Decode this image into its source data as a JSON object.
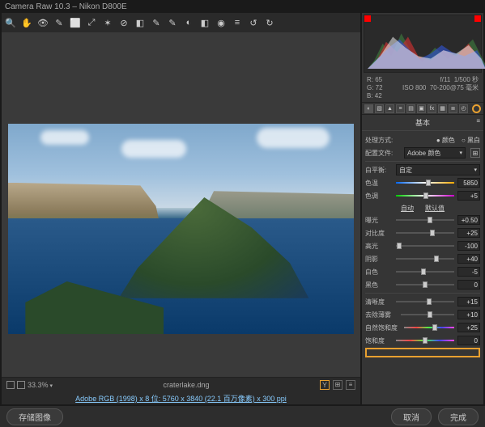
{
  "title": "Camera Raw 10.3 – Nikon D800E",
  "status": {
    "zoom": "33.3%",
    "filename": "craterlake.dng",
    "preview_toggle": "Y"
  },
  "meta_line": "Adobe RGB (1998) x 8 位: 5760 x 3840 (22.1 百万像素) x 300 ppi",
  "info": {
    "r": "R:  65",
    "g": "G:  72",
    "b": "B:  42",
    "aperture": "f/11",
    "shutter": "1/500 秒",
    "iso": "ISO 800",
    "lens": "70-200@75 毫米"
  },
  "panel": {
    "title": "基本",
    "mode_label": "处理方式:",
    "mode_color": "颜色",
    "mode_bw": "黑白",
    "profile_label": "配置文件:",
    "profile_value": "Adobe 颜色",
    "wb_label": "白平衡:",
    "wb_value": "自定",
    "temp_label": "色温",
    "temp_value": "5850",
    "tint_label": "色调",
    "tint_value": "+5",
    "auto": "自动",
    "default": "默认值",
    "exposure_label": "曝光",
    "exposure_value": "+0.50",
    "contrast_label": "对比度",
    "contrast_value": "+25",
    "highlights_label": "高光",
    "highlights_value": "-100",
    "shadows_label": "阴影",
    "shadows_value": "+40",
    "whites_label": "白色",
    "whites_value": "-5",
    "blacks_label": "黑色",
    "blacks_value": "0",
    "clarity_label": "清晰度",
    "clarity_value": "+15",
    "dehaze_label": "去除薄雾",
    "dehaze_value": "+10",
    "vibrance_label": "自然饱和度",
    "vibrance_value": "+25",
    "sat_label": "饱和度",
    "sat_value": "0"
  },
  "footer": {
    "save": "存储图像",
    "cancel": "取消",
    "done": "完成"
  },
  "tool_icons": [
    "🔍",
    "✋",
    "👁",
    "✎",
    "⬜",
    "⤢",
    "✶",
    "⊘",
    "◧",
    "✎",
    "✎",
    "◐",
    "◧",
    "◉",
    "≡",
    "↺",
    "↻"
  ]
}
